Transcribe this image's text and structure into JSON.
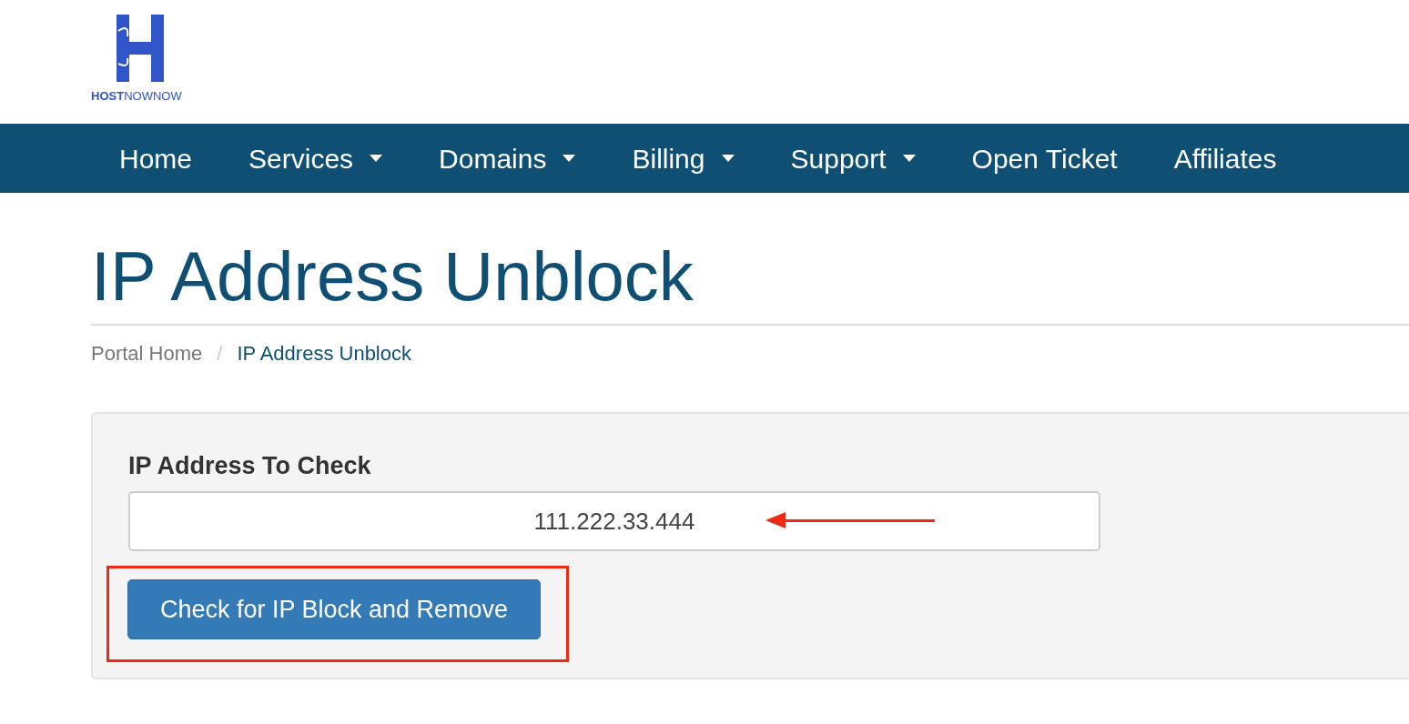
{
  "logo": {
    "text": "**HOST**NOWNOW"
  },
  "nav": [
    {
      "label": "Home",
      "dropdown": false
    },
    {
      "label": "Services",
      "dropdown": true
    },
    {
      "label": "Domains",
      "dropdown": true
    },
    {
      "label": "Billing",
      "dropdown": true
    },
    {
      "label": "Support",
      "dropdown": true
    },
    {
      "label": "Open Ticket",
      "dropdown": false
    },
    {
      "label": "Affiliates",
      "dropdown": false
    }
  ],
  "page_title": "IP Address Unblock",
  "breadcrumb_separator": "/",
  "breadcrumb": [
    {
      "label": "Portal Home",
      "selected": false
    },
    {
      "label": "IP Address Unblock",
      "selected": true
    }
  ],
  "form": {
    "label": "IP Address To Check",
    "value": "111.222.33.444",
    "button": "Check for IP Block and Remove"
  },
  "annotations": {
    "arrow": true,
    "button_highlight": true
  }
}
